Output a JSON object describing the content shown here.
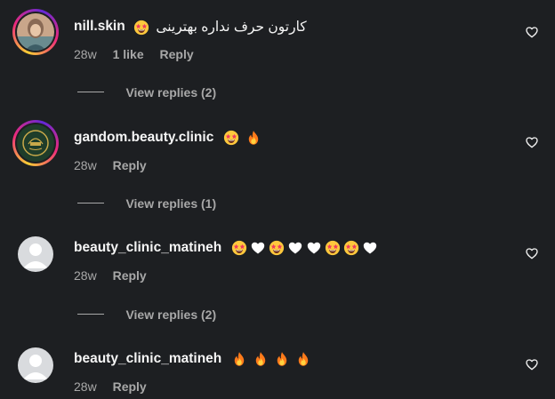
{
  "comments": [
    {
      "username": "nill.skin",
      "text": "کارتون حرف نداره بهترینی",
      "emojis": [
        "star-struck"
      ],
      "time": "28w",
      "likes": "1 like",
      "reply_label": "Reply",
      "view_replies": "View replies (2)"
    },
    {
      "username": "gandom.beauty.clinic",
      "emojis": [
        "star-struck",
        "fire"
      ],
      "time": "28w",
      "reply_label": "Reply",
      "view_replies": "View replies (1)"
    },
    {
      "username": "beauty_clinic_matineh",
      "emojis": [
        "star-struck",
        "white-heart",
        "star-struck",
        "white-heart",
        "white-heart",
        "star-struck",
        "star-struck",
        "white-heart"
      ],
      "time": "28w",
      "reply_label": "Reply",
      "view_replies": "View replies (2)"
    },
    {
      "username": "beauty_clinic_matineh",
      "emojis": [
        "fire",
        "fire",
        "fire",
        "fire"
      ],
      "time": "28w",
      "reply_label": "Reply"
    }
  ],
  "colors": {
    "background": "#1d1f22",
    "primary_text": "#f5f5f5",
    "secondary_text": "#a8a8a8"
  }
}
